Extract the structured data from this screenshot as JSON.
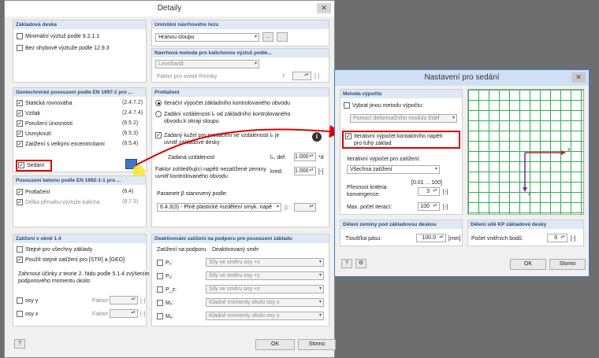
{
  "main": {
    "title": "Detaily",
    "ok": "OK",
    "cancel": "Storno",
    "base_plate": {
      "header": "Základová deska",
      "min_reinf": "Minimální výztuž podle 9.2.1.1",
      "no_shear": "Bez ohybové výztuže podle 12.9.3"
    },
    "section": {
      "header": "Umístění návrhového řezu",
      "combo": "Hranou sloupu"
    },
    "method": {
      "header": "Návrhová metoda pro kalichovou výztuž podle...",
      "combo": "Leonhardt",
      "factor": "Faktor pro svislé třmínky",
      "f": "f",
      "unit": "[-]"
    },
    "geo": {
      "header": "Geotechnické posouzení podle EN 1997-1 pro ...",
      "items": [
        {
          "label": "Statická rovnováha",
          "ref": "(2.4.7.2)"
        },
        {
          "label": "Vztlak",
          "ref": "(2.4.7.4)"
        },
        {
          "label": "Porušení únosnosti",
          "ref": "(6.5.2)"
        },
        {
          "label": "Usmyknutí",
          "ref": "(6.5.3)"
        },
        {
          "label": "Zatížení s velkými excentricitami",
          "ref": "(6.5.4)"
        }
      ],
      "settlement": "Sedání"
    },
    "punch": {
      "header": "Protlačení",
      "r1": "Iterační výpočet základního kontrolovaného obvodu",
      "r2a": "Zadání vzdálenosti lₙ od základního kontrolovaného",
      "r2b": "obvodu k okraji sloupu",
      "c1a": "Zadaný kužel pro protlačení ve vzdálenosti lₙ je",
      "c1b": "uvnitř základové desky",
      "dist_label": "Zadaná vzdálenost",
      "dist_sym": "lₙ, def:",
      "dist_val": "1.000",
      "dist_unit": "*d",
      "fac_a": "Faktor zohledňující napětí nezatížené zeminy",
      "fac_b": "uvnitř kontrolovaného obvodu",
      "fac_sym": "kred:",
      "fac_val": "1.000",
      "fac_unit": "[-]",
      "param_label": "Parametr β stanovený podle:",
      "param_combo": "6.4.3(3) - Plně plastické rozdělení smyk. napě",
      "beta_sym": "β:"
    },
    "concrete": {
      "header": "Posouzení betonu podle EN 1992-1-1 pro ...",
      "punch": "Protlačení",
      "punch_ref": "(6.4)",
      "anchor": "Délka přesahu výztuže kalicha",
      "anchor_ref": "(8.7.3)"
    },
    "load": {
      "header": "Zatížení v okně 1.4",
      "same": "Stejné pro všechny základy",
      "use": "Použít stejné zatížení pro [STR] a [GEO]",
      "consider_a": "Zahrnout účinky z teorie 2. řádu podle 5.1.4 zvýšením",
      "consider_b": "podporového momentu okolo:",
      "axis_y": "osy y",
      "axis_x": "osy x",
      "factor": "Faktor:",
      "unit": "[-]"
    },
    "deact": {
      "header": "Deaktivování zatížení na podporu pro posouzení základu",
      "col1": "Zatížení na podporu",
      "col2": "Deaktivovaný směr",
      "rows": [
        {
          "sym": "Pₓ:",
          "dir": "Síly ve směru osy +x"
        },
        {
          "sym": "Pᵧ:",
          "dir": "Síly ve směru osy +y"
        },
        {
          "sym": "P_z:",
          "dir": "Síly ve směru osy +z"
        },
        {
          "sym": "Mₓ:",
          "dir": "Kladné momenty okolo osy x"
        },
        {
          "sym": "Mᵧ:",
          "dir": "Kladné momenty okolo osy y"
        }
      ]
    }
  },
  "settings": {
    "title": "Nastavení pro sedání",
    "ok": "OK",
    "cancel": "Storno",
    "method": {
      "header": "Metoda výpočtu",
      "select": "Vybrat jinou metodu výpočtu:",
      "combo": "Pomocí deformačního modulu Edef",
      "iter_a": "Iterativní výpočet kontaktního napětí",
      "iter_b": "pro tuhý základ",
      "iter_load": "Iterativní výpočet pro zatížení:",
      "load_combo": "Všechna zatížení",
      "range": "[0.01 ... 100]",
      "acc_a": "Přesnost kritéria",
      "acc_b": "konvergence:",
      "acc_val": "3",
      "acc_unit": "[-]",
      "max_label": "Max. počet iterací:",
      "max_val": "100",
      "max_unit": "[-]"
    },
    "soil": {
      "header": "Dělení zeminy pod základovou deskou",
      "label": "Tloušťka pásu:",
      "val": "100.0",
      "unit": "[mm]"
    },
    "fe": {
      "header": "Dělení sítě KP základové desky",
      "label": "Počet vnitřních bodů:",
      "val": "9",
      "unit": "[-]"
    },
    "axis_x": "x",
    "axis_z": "z"
  }
}
